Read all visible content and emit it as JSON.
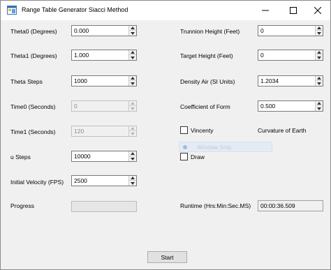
{
  "window": {
    "title": "Range Table Generator Siacci Method"
  },
  "left": {
    "theta0": {
      "label": "Theta0 (Degrees)",
      "value": "0.000"
    },
    "theta1": {
      "label": "Theta1 (Degrees)",
      "value": "1.000"
    },
    "theta_steps": {
      "label": "Theta Steps",
      "value": "1000"
    },
    "time0": {
      "label": "Time0 (Seconds)",
      "value": "0"
    },
    "time1": {
      "label": "Time1 (Seconds)",
      "value": "120"
    },
    "u_steps": {
      "label": "u Steps",
      "value": "10000"
    },
    "initial_velocity": {
      "label": "Initial Velocity (FPS)",
      "value": "2500"
    },
    "progress": {
      "label": "Progress",
      "fraction": 0
    }
  },
  "right": {
    "trunnion_height": {
      "label": "Trunnion Height (Feet)",
      "value": "0"
    },
    "target_height": {
      "label": "Target Height (Feet)",
      "value": "0"
    },
    "density_air": {
      "label": "Density Air (SI Units)",
      "value": "1.2034"
    },
    "coefficient_of_form": {
      "label": "Coefficient of Form",
      "value": "0.500"
    },
    "vincenty": {
      "label": "Vincenty",
      "checked": false
    },
    "curvature_of_earth": {
      "label": "Curvature of Earth"
    },
    "draw": {
      "label": "Draw",
      "checked": false
    },
    "runtime": {
      "label": "Runtime (Hrs:Min:Sec.MS)",
      "value": "00:00:36.509"
    }
  },
  "overlay": {
    "label": "Window Snip"
  },
  "actions": {
    "start_label": "Start"
  },
  "colors": {
    "window_bg": "#f0f0f0",
    "field_border": "#7a7a7a",
    "progress_fill": "#06b025"
  }
}
